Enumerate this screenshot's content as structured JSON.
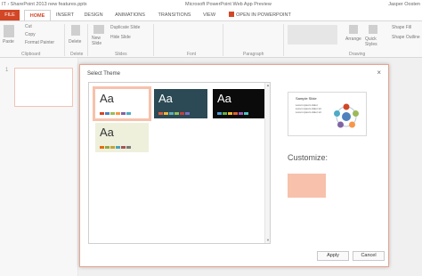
{
  "titlebar": {
    "file_title": "IT › SharePoint 2013 new features.pptx",
    "app_title": "Microsoft PowerPoint Web App Preview",
    "user": "Jasper Oosten"
  },
  "tabs": [
    {
      "label": "FILE"
    },
    {
      "label": "HOME"
    },
    {
      "label": "INSERT"
    },
    {
      "label": "DESIGN"
    },
    {
      "label": "ANIMATIONS"
    },
    {
      "label": "TRANSITIONS"
    },
    {
      "label": "VIEW"
    },
    {
      "label": "OPEN IN POWERPOINT"
    }
  ],
  "ribbon": {
    "paste": "Paste",
    "cut": "Cut",
    "copy": "Copy",
    "format_painter": "Format Painter",
    "delete": "Delete",
    "new_slide": "New Slide",
    "duplicate_slide": "Duplicate Slide",
    "hide_slide": "Hide Slide",
    "arrange": "Arrange",
    "quick_styles": "Quick Styles",
    "shape_fill": "Shape Fill",
    "shape_outline": "Shape Outline",
    "groups": {
      "clipboard": "Clipboard",
      "delete": "Delete",
      "slides": "Slides",
      "font": "Font",
      "paragraph": "Paragraph",
      "drawing": "Drawing"
    }
  },
  "slide_number": "1",
  "dialog": {
    "title": "Select Theme",
    "preview": {
      "title": "Sample Slide",
      "bullets": [
        "Lorem ipsum dolor",
        "Lorem ipsum dolor sit",
        "Lorem ipsum dolor sit"
      ]
    },
    "customize_label": "Customize:",
    "customize_color": "#f7c1ac",
    "apply": "Apply",
    "cancel": "Cancel"
  },
  "themes": [
    {
      "label": "Aa",
      "bg": "#ffffff",
      "text": "#333333",
      "selected": true,
      "swatches": [
        "#d24726",
        "#4f81bd",
        "#9bbb59",
        "#f79646",
        "#8064a2",
        "#4bacc6"
      ]
    },
    {
      "label": "Aa",
      "bg": "#2b4a55",
      "text": "#ffffff",
      "selected": false,
      "swatches": [
        "#e05a37",
        "#f0b63a",
        "#5eb0b9",
        "#8fc25d",
        "#c63f3f",
        "#7b6fc4"
      ]
    },
    {
      "label": "Aa",
      "bg": "#0b0b0b",
      "text": "#ffffff",
      "selected": false,
      "swatches": [
        "#4e9ed9",
        "#66b245",
        "#f1b72c",
        "#e0632f",
        "#9b59b6",
        "#4fc3c3"
      ]
    },
    {
      "label": "Aa",
      "bg": "#eef0dc",
      "text": "#333333",
      "selected": false,
      "swatches": [
        "#e46c0a",
        "#93a640",
        "#c7a236",
        "#4ba3b9",
        "#a4545a",
        "#7a7a7a"
      ]
    }
  ]
}
